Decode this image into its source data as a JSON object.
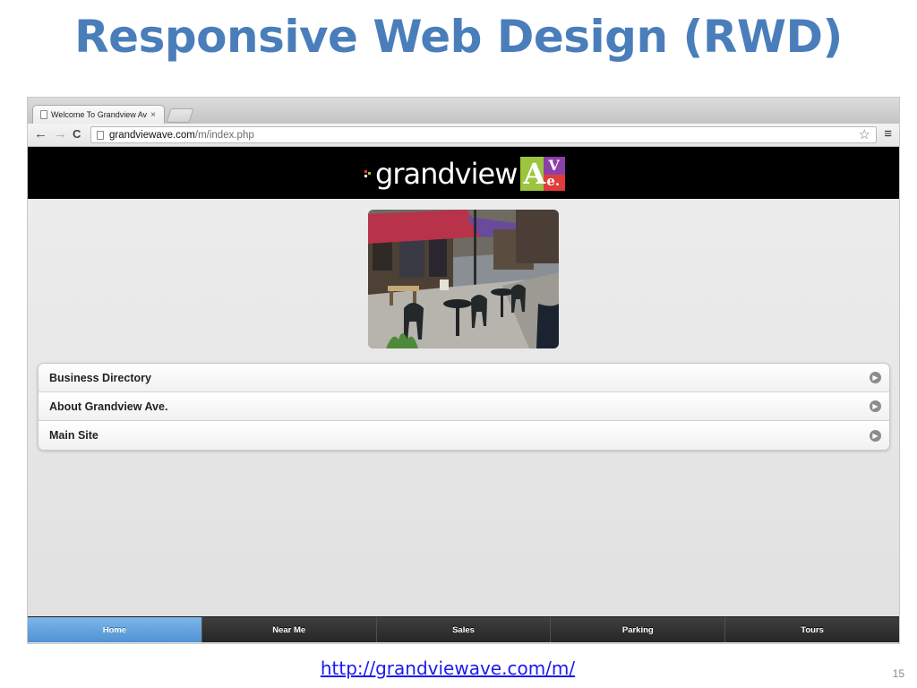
{
  "slide": {
    "title": "Responsive Web Design (RWD)",
    "link": "http://grandviewave.com/m/",
    "page_number": "15"
  },
  "browser": {
    "tab_title": "Welcome To Grandview Av",
    "tab_close": "×",
    "url_host": "grandviewave.com",
    "url_path": "/m/index.php",
    "back": "←",
    "forward": "→",
    "reload": "C",
    "bookmark": "☆",
    "menu": "≡"
  },
  "site": {
    "logo_text": "grandview",
    "logo_badge_A": "A",
    "logo_badge_V": "V",
    "logo_badge_e": "e.",
    "menu": [
      {
        "label": "Business Directory"
      },
      {
        "label": "About Grandview Ave."
      },
      {
        "label": "Main Site"
      }
    ],
    "arrow_glyph": "▶",
    "bottom_nav": [
      {
        "label": "Home",
        "active": true
      },
      {
        "label": "Near Me"
      },
      {
        "label": "Sales"
      },
      {
        "label": "Parking"
      },
      {
        "label": "Tours"
      }
    ]
  },
  "colors": {
    "title": "#4a7ebb",
    "active_tab": "#5a9ad8",
    "header_bg": "#000000",
    "badge_green": "#9bc53d",
    "badge_red": "#e23b3b",
    "badge_purple": "#8b3fa8"
  }
}
